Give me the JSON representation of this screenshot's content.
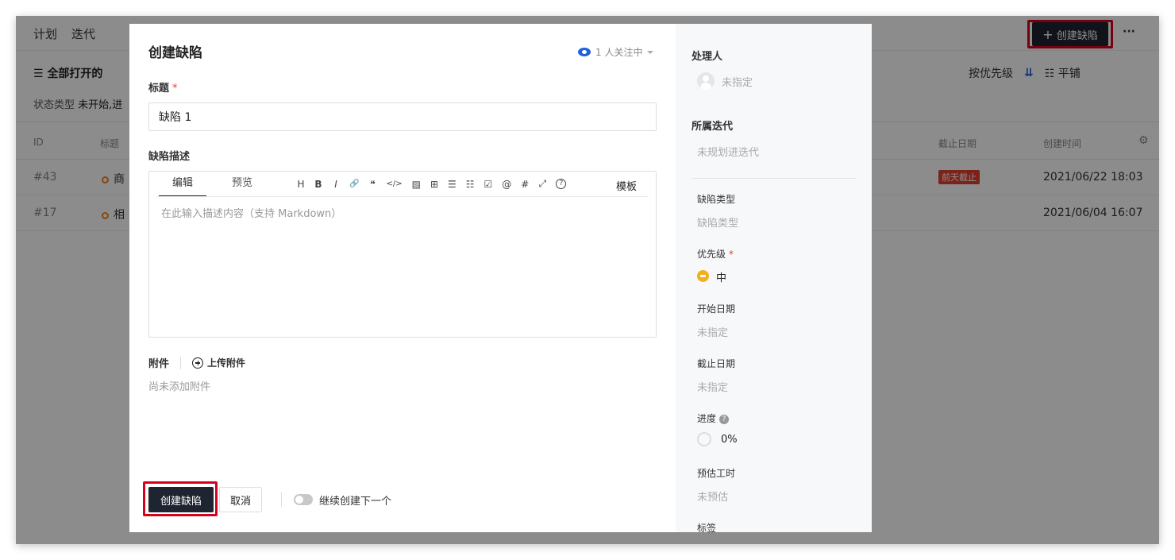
{
  "background": {
    "nav": [
      "计划",
      "迭代"
    ],
    "create_label": "创建缺陷",
    "more_label": "···",
    "filter_label": "全部打开的",
    "status_prefix": "状态类型",
    "status_value": "未开始,进",
    "sort_label": "按优先级",
    "view_label": "平铺",
    "table_headers": {
      "id": "ID",
      "title": "标题",
      "due": "截止日期",
      "created": "创建时间"
    },
    "rows": [
      {
        "id": "#43",
        "title": "商",
        "badge": "前天截止",
        "created": "2021/06/22 18:03"
      },
      {
        "id": "#17",
        "title": "相",
        "badge": "",
        "created": "2021/06/04 16:07"
      }
    ]
  },
  "modal": {
    "title": "创建缺陷",
    "watch_label": "1 人关注中",
    "field_title_label": "标题",
    "required_mark": "*",
    "title_value": "缺陷 1",
    "desc_label": "缺陷描述",
    "editor_tabs": [
      "编辑",
      "预览"
    ],
    "editor_tools": [
      "H",
      "B",
      "I",
      "🔗",
      "❝",
      "</>",
      "▨",
      "⊞",
      "☰",
      "☷",
      "☑",
      "@",
      "#",
      "⤢",
      "?"
    ],
    "template_label": "模板",
    "desc_placeholder": "在此输入描述内容（支持 Markdown）",
    "attach_label": "附件",
    "upload_label": "上传附件",
    "attach_empty": "尚未添加附件",
    "create_button": "创建缺陷",
    "cancel_button": "取消",
    "continue_label": "继续创建下一个"
  },
  "sidebar": {
    "assignee_label": "处理人",
    "assignee_value": "未指定",
    "iteration_label": "所属迭代",
    "iteration_value": "未规划进迭代",
    "type_label": "缺陷类型",
    "type_value": "缺陷类型",
    "priority_label": "优先级",
    "priority_value": "中",
    "start_label": "开始日期",
    "start_value": "未指定",
    "due_label": "截止日期",
    "due_value": "未指定",
    "progress_label": "进度",
    "progress_value": "0%",
    "estimate_label": "预估工时",
    "estimate_value": "未预估",
    "tags_label": "标签"
  }
}
